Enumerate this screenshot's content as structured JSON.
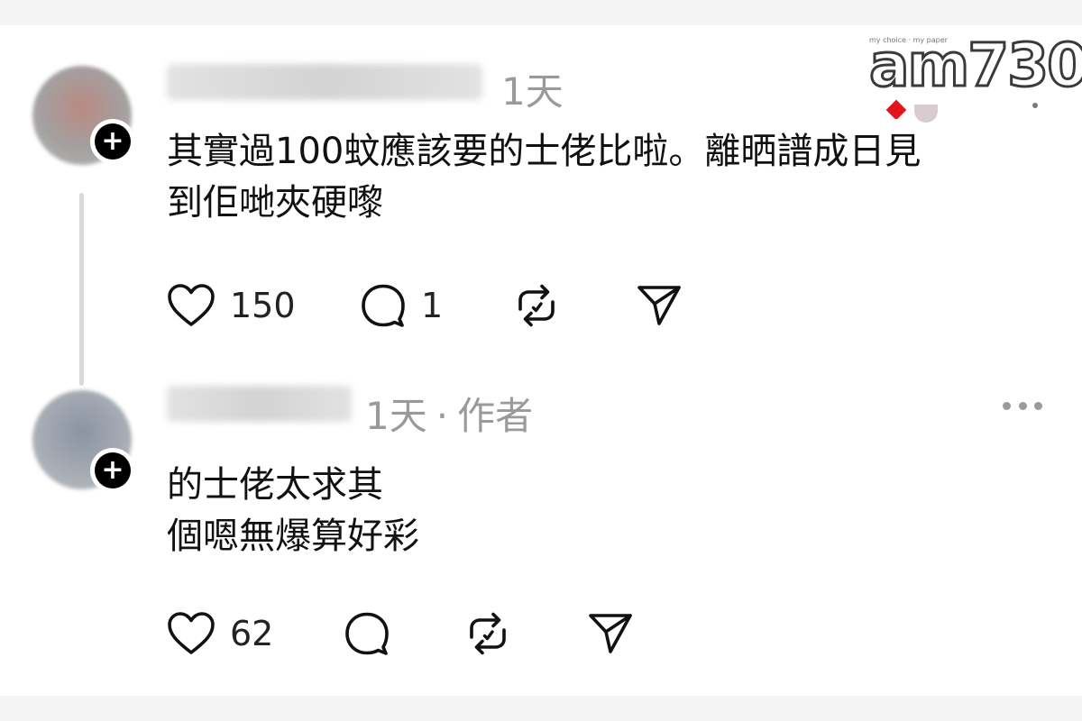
{
  "watermark": {
    "tagline": "my choice · my paper",
    "logo": "am730"
  },
  "posts": [
    {
      "time": "1天",
      "author_tag": "",
      "content": "其實過100蚊應該要的士佬比啦。離晒譜成日見\n到佢哋夾硬嚟",
      "likes": "150",
      "replies": "1",
      "icons": [
        "follow-plus-icon",
        "heart-icon",
        "comment-icon",
        "repost-icon",
        "send-icon"
      ]
    },
    {
      "time": "1天",
      "author_tag": "作者",
      "separator": "·",
      "content": "的士佬太求其\n個嗯無爆算好彩",
      "likes": "62",
      "replies": "",
      "icons": [
        "follow-plus-icon",
        "more-icon",
        "heart-icon",
        "comment-icon",
        "repost-icon",
        "send-icon"
      ]
    }
  ],
  "colors": {
    "background": "#f4f4f4",
    "card": "#ffffff",
    "text": "#111111",
    "meta": "#9a9a9a",
    "thread_line": "#d9d9d9",
    "badge": "#000000"
  }
}
